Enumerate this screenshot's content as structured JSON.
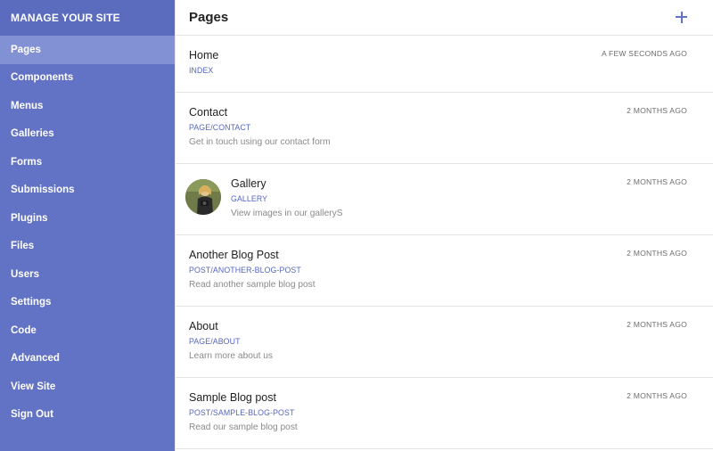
{
  "sidebar": {
    "header": "MANAGE YOUR SITE",
    "items": [
      {
        "label": "Pages",
        "active": true
      },
      {
        "label": "Components"
      },
      {
        "label": "Menus"
      },
      {
        "label": "Galleries"
      },
      {
        "label": "Forms"
      },
      {
        "label": "Submissions"
      },
      {
        "label": "Plugins"
      },
      {
        "label": "Files"
      },
      {
        "label": "Users"
      },
      {
        "label": "Settings"
      },
      {
        "label": "Code"
      },
      {
        "label": "Advanced"
      },
      {
        "label": "View Site"
      },
      {
        "label": "Sign Out"
      }
    ]
  },
  "main": {
    "title": "Pages",
    "add_icon": "plus-icon",
    "pages": [
      {
        "title": "Home",
        "slug": "INDEX",
        "desc": "",
        "time": "A FEW SECONDS AGO"
      },
      {
        "title": "Contact",
        "slug": "PAGE/CONTACT",
        "desc": "Get in touch using our contact form",
        "time": "2 MONTHS AGO"
      },
      {
        "title": "Gallery",
        "slug": "GALLERY",
        "desc": "View images in our galleryS",
        "time": "2 MONTHS AGO",
        "thumbnail": "gallery-thumbnail"
      },
      {
        "title": "Another Blog Post",
        "slug": "POST/ANOTHER-BLOG-POST",
        "desc": "Read another sample blog post",
        "time": "2 MONTHS AGO"
      },
      {
        "title": "About",
        "slug": "PAGE/ABOUT",
        "desc": "Learn more about us",
        "time": "2 MONTHS AGO"
      },
      {
        "title": "Sample Blog post",
        "slug": "POST/SAMPLE-BLOG-POST",
        "desc": "Read our sample blog post",
        "time": "2 MONTHS AGO"
      }
    ]
  },
  "colors": {
    "sidebar_bg": "#6272c4",
    "sidebar_active": "#8291d3",
    "accent": "#5566c0",
    "divider": "#e3e3e3"
  }
}
